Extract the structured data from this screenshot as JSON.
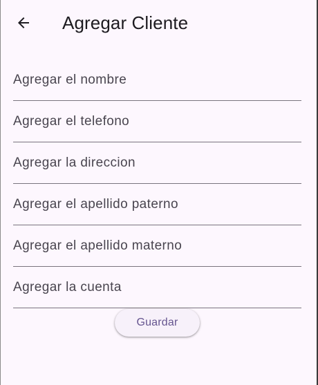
{
  "appbar": {
    "title": "Agregar Cliente",
    "back_icon": "arrow-left-icon"
  },
  "form": {
    "fields": [
      {
        "placeholder": "Agregar el nombre",
        "value": ""
      },
      {
        "placeholder": "Agregar el telefono",
        "value": ""
      },
      {
        "placeholder": "Agregar la direccion",
        "value": ""
      },
      {
        "placeholder": "Agregar el apellido paterno",
        "value": ""
      },
      {
        "placeholder": "Agregar el apellido materno",
        "value": ""
      },
      {
        "placeholder": "Agregar la cuenta",
        "value": ""
      }
    ],
    "save_label": "Guardar"
  },
  "colors": {
    "background": "#fdf7fe",
    "accent": "#65558f",
    "divider": "#79747e",
    "placeholder": "#49454f"
  }
}
